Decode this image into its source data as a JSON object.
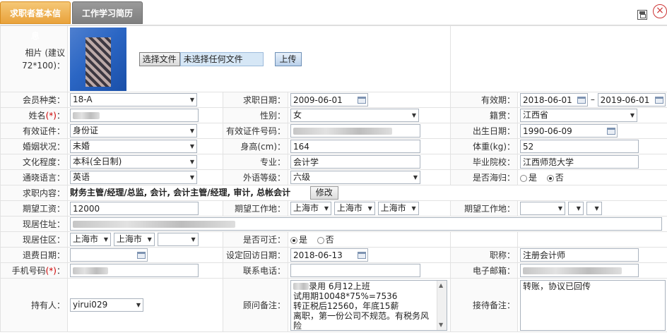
{
  "tabs": [
    {
      "label": "求职者基本信息"
    },
    {
      "label": "工作学习简历"
    }
  ],
  "photo": {
    "label": "相片 (建议72*100)：",
    "choose_file_label": "选择文件",
    "no_file_text": "未选择任何文件",
    "upload_label": "上传"
  },
  "labels": {
    "member_type": "会员种类：",
    "apply_date": "求职日期：",
    "valid_period": "有效期：",
    "name": "姓名",
    "required_mark": "(*)",
    "colon": "：",
    "gender": "性别：",
    "native_place": "籍贯：",
    "id_type": "有效证件：",
    "id_number": "有效证件号码：",
    "birth_date": "出生日期：",
    "marital": "婚姻状况：",
    "height": "身高(cm)：",
    "weight": "体重(kg)：",
    "education": "文化程度：",
    "major": "专业：",
    "school": "毕业院校：",
    "language": "通晓语言：",
    "foreign_level": "外语等级：",
    "returnee": "是否海归：",
    "job_content": "求职内容：",
    "expected_salary": "期望工资：",
    "expected_location": "期望工作地：",
    "current_address": "现居住址：",
    "current_area": "现居住区：",
    "relocate": "是否可迁：",
    "refund_date": "退费日期：",
    "revisit_date": "设定回访日期：",
    "title": "职称：",
    "mobile": "手机号码",
    "phone": "联系电话：",
    "email": "电子邮箱：",
    "holder": "持有人：",
    "consultant_note": "顾问备注：",
    "reception_note": "接待备注："
  },
  "values": {
    "member_type": "18-A",
    "apply_date": "2009-06-01",
    "valid_from": "2018-06-01",
    "valid_sep": "–",
    "valid_to": "2019-06-01",
    "gender": "女",
    "native_place": "江西省",
    "id_type": "身份证",
    "birth_date": "1990-06-09",
    "marital": "未婚",
    "height": "164",
    "weight": "52",
    "education": "本科(全日制)",
    "major": "会计学",
    "school": "江西师范大学",
    "language": "英语",
    "foreign_level": "六级",
    "returnee_yes": "是",
    "returnee_no": "否",
    "job_content": "财务主管/经理/总监, 会计, 会计主管/经理, 审计, 总帐会计",
    "modify_label": "修改",
    "expected_salary": "12000",
    "loc1": "上海市",
    "loc2": "上海市",
    "loc3": "上海市",
    "area1": "上海市",
    "area2": "上海市",
    "relocate_yes": "是",
    "relocate_no": "否",
    "revisit_date": "2018-06-13",
    "title": "注册会计师",
    "holder": "yirui029",
    "consultant_note_lines": [
      "录用 6月12上班",
      "试用期10048*75%=7536",
      "转正税后12560，年底15薪",
      "离职，第一份公司不规范。有税务风险"
    ],
    "reception_note": "转账，协议已回传"
  }
}
